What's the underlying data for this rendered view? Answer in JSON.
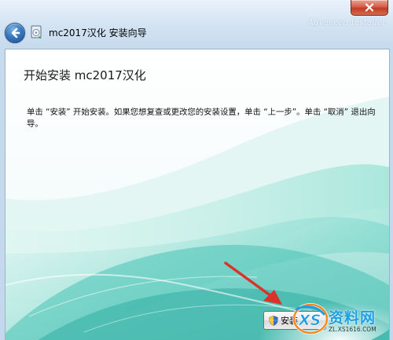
{
  "window": {
    "title": "mc2017汉化 安装向导",
    "watermark": "Advanced Installer"
  },
  "content": {
    "heading": "开始安装 mc2017汉化",
    "description": "单击 “安装” 开始安装。如果您想复查或更改您的安装设置，单击 “上一步”。单击 “取消” 退出向导。"
  },
  "buttons": {
    "install_label": "安装"
  },
  "site_logo": {
    "name": "资料网",
    "url": "ZL.XS1616.COM"
  },
  "icons": {
    "back": "back-arrow-icon",
    "app": "installer-app-icon",
    "close": "close-icon",
    "install_shield": "uac-shield-icon",
    "annotation": "red-arrow-icon",
    "logo": "xs-logo-icon"
  },
  "colors": {
    "annotation_arrow": "#d9332b",
    "logo_text": "#1e9ee0",
    "close_button": "#c23b22"
  }
}
